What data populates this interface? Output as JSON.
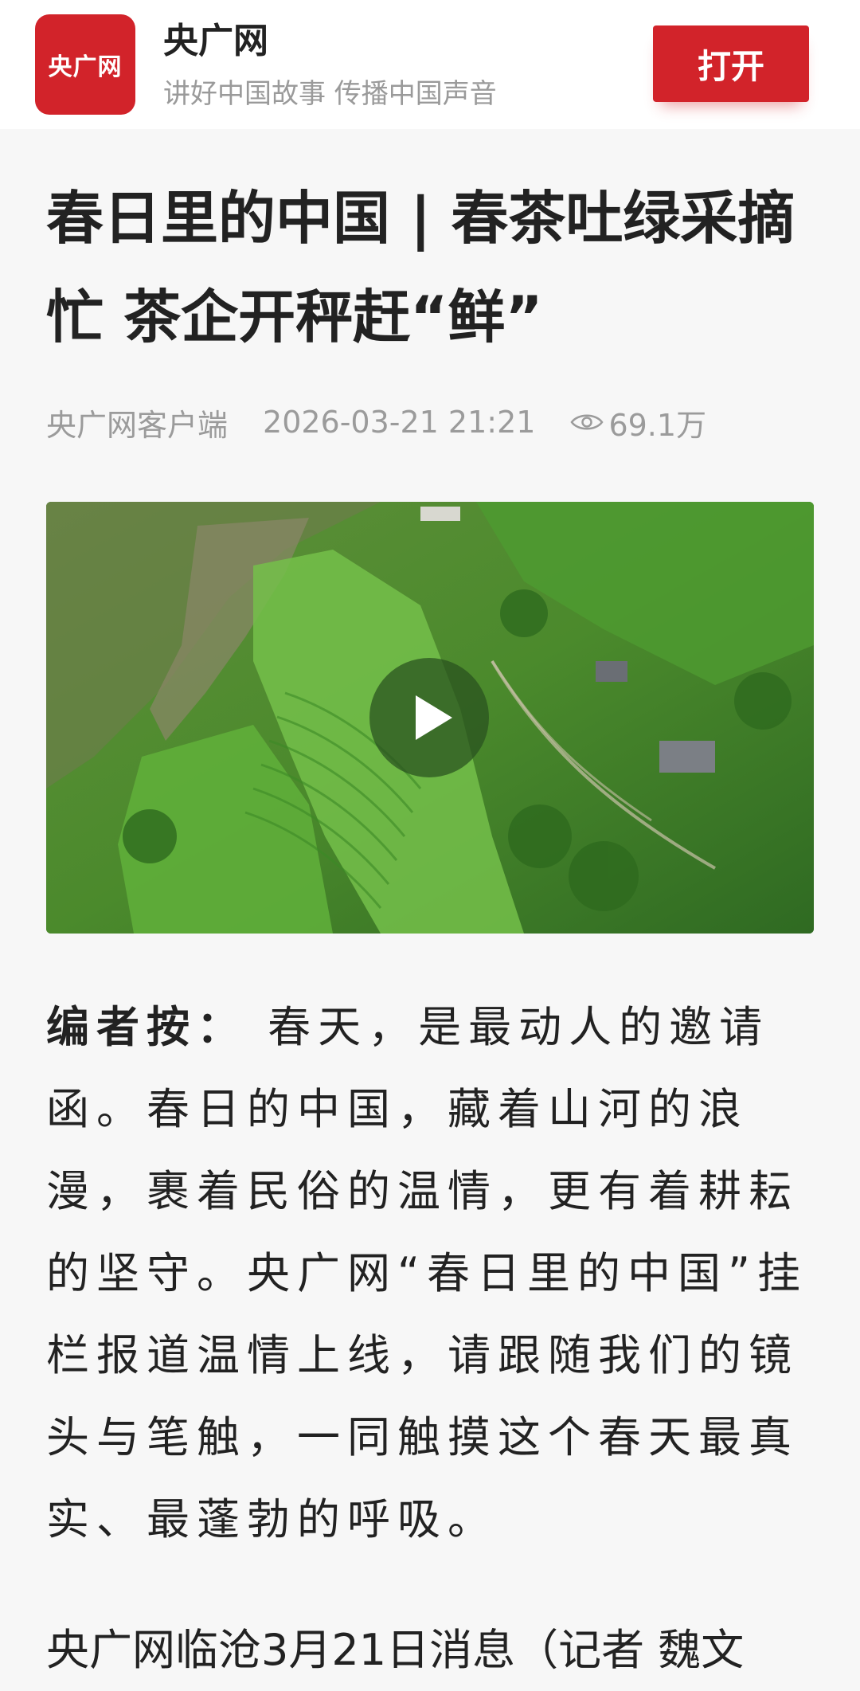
{
  "header": {
    "logo_text": "央广网",
    "app_name": "央广网",
    "slogan": "讲好中国故事 传播中国声音",
    "open_button": "打开"
  },
  "article": {
    "title": "春日里的中国 | 春茶吐绿采摘忙 茶企开秤赶“鲜”",
    "source": "央广网客户端",
    "datetime": "2026-03-21 21:21",
    "views": "69.1万",
    "editor_label": "编者按：",
    "editor_text": "春天，是最动人的邀请函。春日的中国，藏着山河的浪漫，裹着民俗的温情，更有着耕耘的坚守。央广网“春日里的中国”挂栏报道温情上线，请跟随我们的镜头与笔触，一同触摸这个春天最真实、最蓬勃的呼吸。",
    "first_paragraph": "央广网临沧3月21日消息（记者 魏文"
  },
  "icons": {
    "view": "eye-icon",
    "play": "play-icon"
  },
  "colors": {
    "brand_red": "#d2232a",
    "meta_gray": "#9b9b9b",
    "background": "#f7f7f7"
  }
}
